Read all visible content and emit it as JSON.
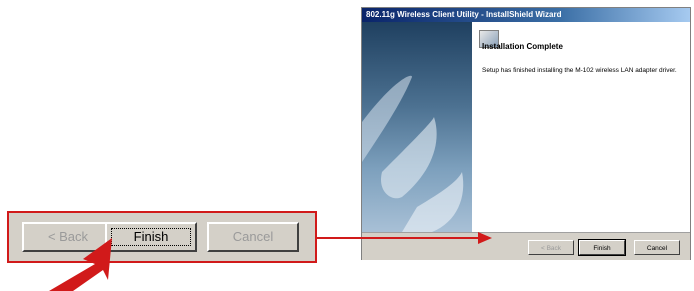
{
  "window": {
    "title": "802.11g Wireless Client Utility - InstallShield Wizard"
  },
  "wizard": {
    "heading": "Installation Complete",
    "message": "Setup has finished installing the M-102 wireless LAN adapter driver.",
    "buttons": {
      "back": "< Back",
      "finish": "Finish",
      "cancel": "Cancel"
    }
  },
  "zoom": {
    "buttons": {
      "back": "< Back",
      "finish": "Finish",
      "cancel": "Cancel"
    }
  },
  "colors": {
    "highlight": "#d11a1a",
    "title_bar": "#0a246a",
    "dialog_gray": "#d4d0c8"
  },
  "icons": {
    "wizard_icon": "installshield-monitor-icon",
    "pointer": "red-arrow-icon",
    "connector": "red-connector-arrow-icon"
  }
}
